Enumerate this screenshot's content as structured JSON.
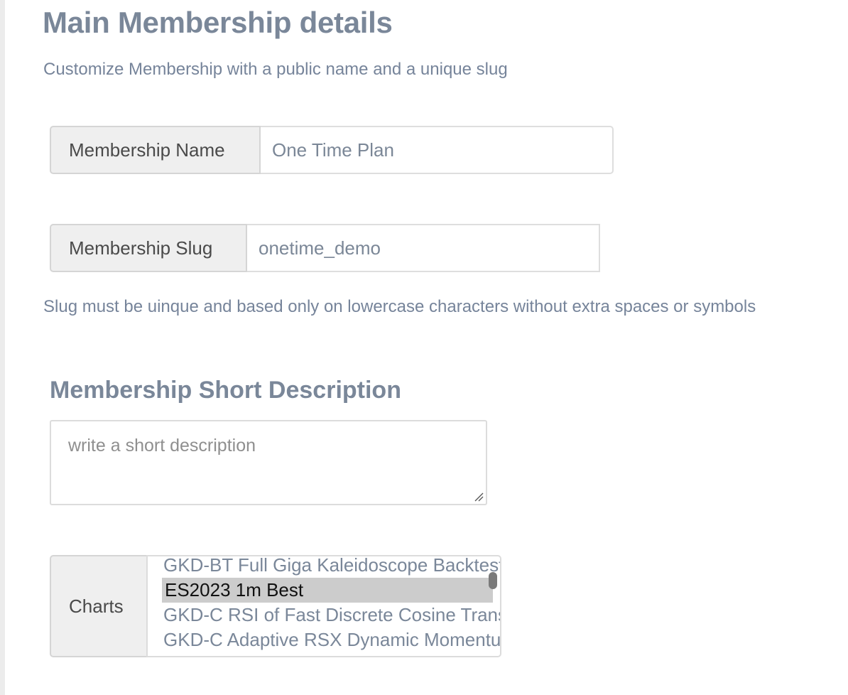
{
  "header": {
    "title": "Main Membership details",
    "subtitle": "Customize Membership with a public name and a unique slug"
  },
  "membership_name": {
    "label": "Membership Name",
    "value": "One Time Plan"
  },
  "membership_slug": {
    "label": "Membership Slug",
    "value": "onetime_demo",
    "hint": "Slug must be uinque and based only on lowercase characters without extra spaces or symbols"
  },
  "short_description": {
    "title": "Membership Short Description",
    "placeholder": "write a short description",
    "value": ""
  },
  "charts": {
    "label": "Charts",
    "options": [
      "GKD-BT Full Giga Kaleidoscope Backtest",
      "ES2023 1m Best",
      "GKD-C RSI of Fast Discrete Cosine Transform",
      "GKD-C Adaptive RSX Dynamic Momentum"
    ],
    "selected": "ES2023 1m Best"
  },
  "icons": {
    "resize": "resize-grip-icon",
    "scroll": "scrollbar-thumb"
  }
}
